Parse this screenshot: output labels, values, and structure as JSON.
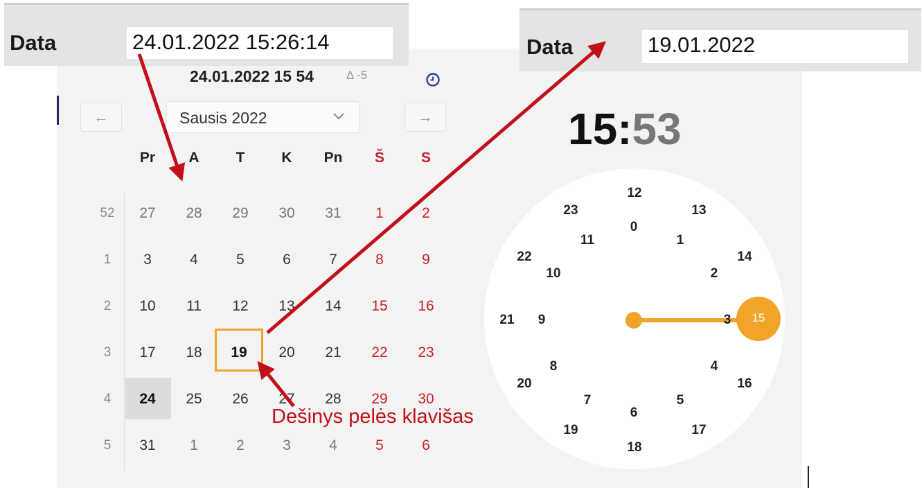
{
  "top_left_field": {
    "label": "Data",
    "value": "24.01.2022 15:26:14"
  },
  "top_right_field": {
    "label": "Data",
    "value": "19.01.2022"
  },
  "picker": {
    "current_datetime": "24.01.2022 15 54",
    "delta": "Δ -5",
    "prev_label": "←",
    "next_label": "→",
    "month_label": "Sausis 2022",
    "weekdays": [
      "Pr",
      "A",
      "T",
      "K",
      "Pn",
      "Š",
      "S"
    ],
    "week_numbers": [
      "52",
      "1",
      "2",
      "3",
      "4",
      "5"
    ],
    "days": [
      [
        "27",
        "28",
        "29",
        "30",
        "31",
        "1",
        "2"
      ],
      [
        "3",
        "4",
        "5",
        "6",
        "7",
        "8",
        "9"
      ],
      [
        "10",
        "11",
        "12",
        "13",
        "14",
        "15",
        "16"
      ],
      [
        "17",
        "18",
        "19",
        "20",
        "21",
        "22",
        "23"
      ],
      [
        "24",
        "25",
        "26",
        "27",
        "28",
        "29",
        "30"
      ],
      [
        "31",
        "1",
        "2",
        "3",
        "4",
        "5",
        "6"
      ]
    ],
    "today": "24",
    "selected": "19"
  },
  "clock": {
    "hour": "15",
    "separator": ":",
    "minute": "53",
    "outer_hours": [
      "12",
      "13",
      "14",
      "15",
      "16",
      "17",
      "18",
      "19",
      "20",
      "21",
      "22",
      "23"
    ],
    "inner_hours": [
      "0",
      "1",
      "2",
      "3",
      "4",
      "5",
      "6",
      "7",
      "8",
      "9",
      "10",
      "11"
    ],
    "selected_hour": "15",
    "accent": "#f0a52a"
  },
  "annotation": {
    "text": "Dešinys pelės klavišas",
    "arrow_color": "#c0101a"
  },
  "colors": {
    "weekend": "#c8202a",
    "selection": "#f0a52a",
    "today_bg": "#dcdcdc"
  }
}
